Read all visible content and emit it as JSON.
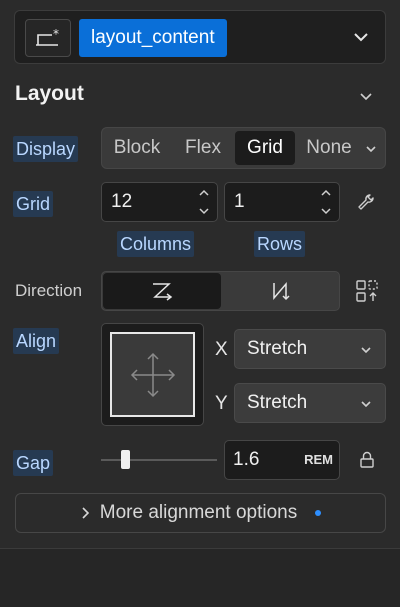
{
  "selector": {
    "chip_label": "layout_content",
    "icon": "element-style-icon",
    "chevron": "chevron-down-icon"
  },
  "section": {
    "title": "Layout",
    "chevron": "chevron-down-icon"
  },
  "display": {
    "label": "Display",
    "options": [
      "Block",
      "Flex",
      "Grid",
      "None"
    ],
    "selected": "Grid"
  },
  "grid": {
    "label": "Grid",
    "columns_value": "12",
    "rows_value": "1",
    "columns_label": "Columns",
    "rows_label": "Rows",
    "tool_icon": "wrench-icon"
  },
  "direction": {
    "label": "Direction",
    "options": [
      "row-icon",
      "column-icon"
    ],
    "selected": "row-icon",
    "extra_icon": "grid-wrap-icon"
  },
  "align": {
    "label": "Align",
    "x_label": "X",
    "x_value": "Stretch",
    "y_label": "Y",
    "y_value": "Stretch"
  },
  "gap": {
    "label": "Gap",
    "value": "1.6",
    "unit": "REM",
    "lock_icon": "lock-icon"
  },
  "more_options": {
    "label": "More alignment options",
    "chevron": "chevron-right-icon"
  },
  "colors": {
    "accent": "#0a6fd8",
    "label_bg": "#263a52",
    "label_text": "#b9d7ff",
    "dot": "#2e8fff"
  }
}
